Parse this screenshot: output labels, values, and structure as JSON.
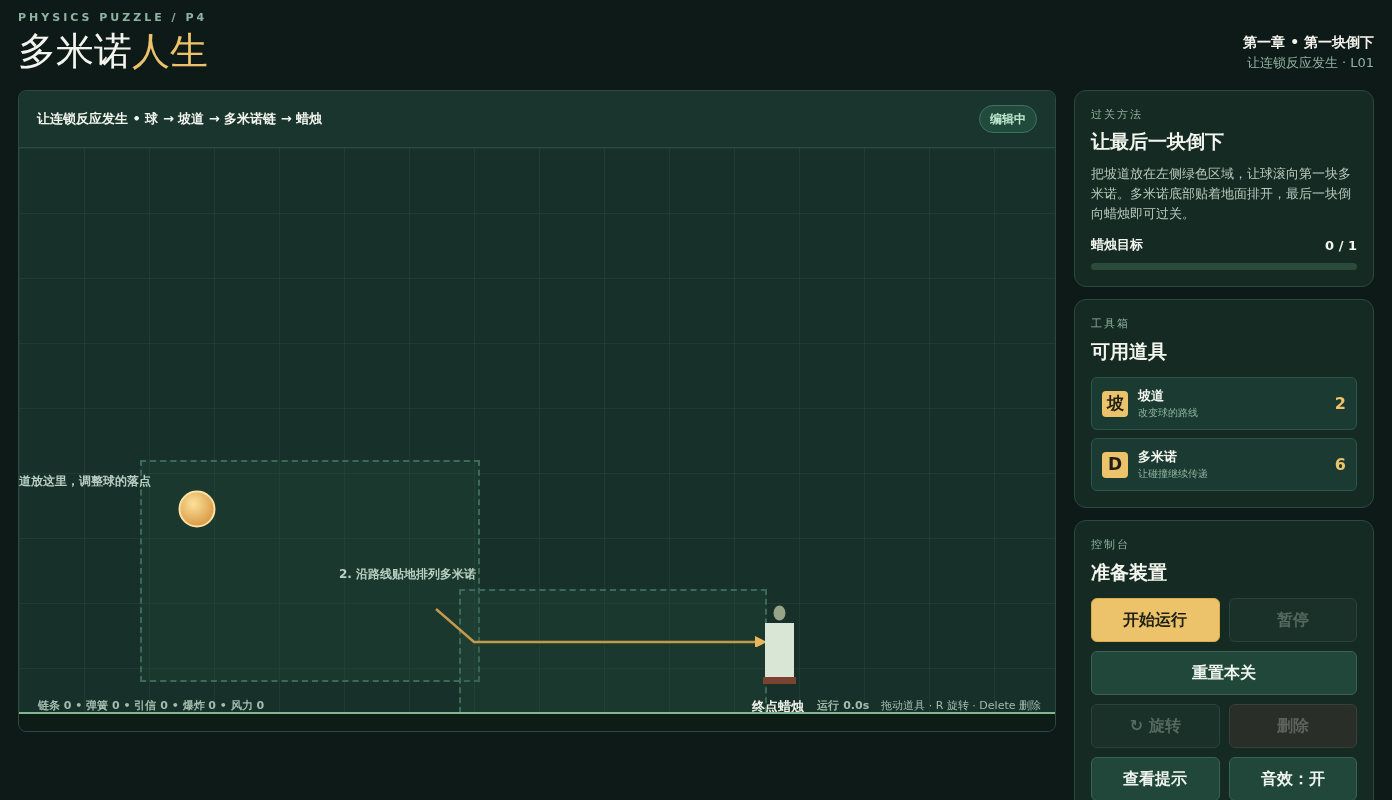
{
  "header": {
    "eyebrow": "PHYSICS PUZZLE / P4",
    "title_main": "多米诺",
    "title_accent": "人生",
    "chapter": "第一章 • 第一块倒下",
    "subtitle": "让连锁反应发生 · L01"
  },
  "stage": {
    "caption": "让连锁反应发生 • 球 → 坡道 → 多米诺链 → 蜡烛",
    "badge": "编辑中",
    "zone_labels": [
      "道放这里，调整球的落点",
      "2. 沿路线贴地排列多米诺"
    ],
    "target_label": "终点蜡烛",
    "stats": "链条 0 • 弹簧 0 • 引信 0 • 爆炸 0 • 风力 0",
    "hint": "拖动道具 · R 旋转 · Delete 删除",
    "timer": "运行 0.0s"
  },
  "goal": {
    "eyebrow": "过关方法",
    "title": "让最后一块倒下",
    "description": "把坡道放在左侧绿色区域，让球滚向第一块多米诺。多米诺底部贴着地面排开，最后一块倒向蜡烛即可过关。",
    "progress_label": "蜡烛目标",
    "progress_value": "0 / 1",
    "level": 0
  },
  "toolbox": {
    "eyebrow": "工具箱",
    "title": "可用道具",
    "tools": [
      {
        "glyph": "坡",
        "name": "坡道",
        "description": "改变球的路线",
        "count": "2"
      },
      {
        "glyph": "D",
        "name": "多米诺",
        "description": "让碰撞继续传递",
        "count": "6"
      }
    ]
  },
  "console": {
    "eyebrow": "控制台",
    "title": "准备装置",
    "buttons": [
      {
        "label": "开始运行",
        "kind": "primary",
        "disabled": false,
        "wide": false
      },
      {
        "label": "暂停",
        "kind": "normal",
        "disabled": true,
        "wide": false
      },
      {
        "label": "重置本关",
        "kind": "normal",
        "disabled": false,
        "wide": true
      },
      {
        "label": "↻ 旋转",
        "kind": "normal",
        "disabled": true,
        "wide": false
      },
      {
        "label": "删除",
        "kind": "danger",
        "disabled": true,
        "wide": false
      },
      {
        "label": "查看提示",
        "kind": "normal",
        "disabled": false,
        "wide": false
      },
      {
        "label": "音效：开",
        "kind": "normal",
        "disabled": false,
        "wide": false
      }
    ]
  }
}
